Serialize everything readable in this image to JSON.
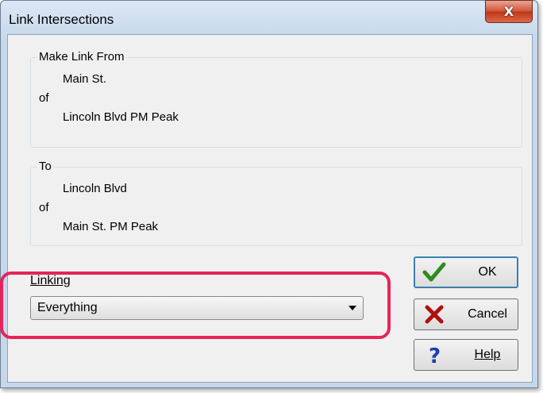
{
  "window": {
    "title": "Link Intersections",
    "close_label": "X"
  },
  "from_group": {
    "legend": "Make Link From",
    "street": "Main St.",
    "of_label": "of",
    "intersection": "Lincoln Blvd PM Peak"
  },
  "to_group": {
    "legend": "To",
    "street": "Lincoln Blvd",
    "of_label": "of",
    "intersection": "Main St. PM Peak"
  },
  "linking": {
    "label": "Linking",
    "selected": "Everything"
  },
  "buttons": {
    "ok": "OK",
    "cancel": "Cancel",
    "help": "Help"
  },
  "colors": {
    "highlight": "#e5245a",
    "ok_check": "#2e8b1e",
    "cancel_x": "#b01010",
    "help_q": "#1a3fb0"
  },
  "icons": {
    "ok": "checkmark-icon",
    "cancel": "red-x-icon",
    "help": "question-mark-icon"
  }
}
